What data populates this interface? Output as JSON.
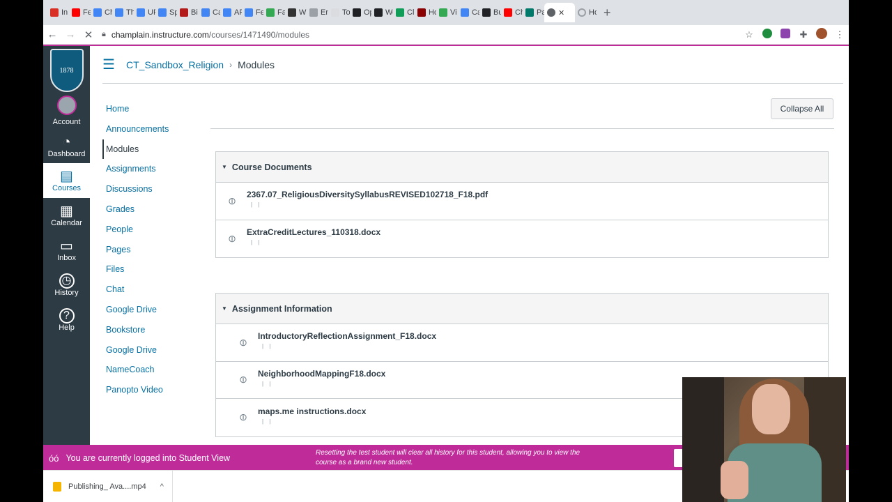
{
  "browser": {
    "tabs": [
      {
        "label": "In",
        "color": "#d93025"
      },
      {
        "label": "Fe",
        "color": "#ff0000"
      },
      {
        "label": "Ch",
        "color": "#4285f4"
      },
      {
        "label": "Th",
        "color": "#4285f4"
      },
      {
        "label": "UF",
        "color": "#4285f4"
      },
      {
        "label": "Sp",
        "color": "#4285f4"
      },
      {
        "label": "Bi",
        "color": "#b31b1b"
      },
      {
        "label": "Ca",
        "color": "#4285f4"
      },
      {
        "label": "AF",
        "color": "#4285f4"
      },
      {
        "label": "Fe",
        "color": "#4285f4"
      },
      {
        "label": "Fa",
        "color": "#34a853"
      },
      {
        "label": "W",
        "color": "#333333"
      },
      {
        "label": "En",
        "color": "#9aa0a6"
      },
      {
        "label": "To",
        "color": "#dadce0"
      },
      {
        "label": "Op",
        "color": "#202124"
      },
      {
        "label": "We",
        "color": "#202124"
      },
      {
        "label": "Cl",
        "color": "#0f9d58"
      },
      {
        "label": "Ho",
        "color": "#8b0000"
      },
      {
        "label": "Vi",
        "color": "#34a853"
      },
      {
        "label": "Ca",
        "color": "#4285f4"
      },
      {
        "label": "Bu",
        "color": "#202124"
      },
      {
        "label": "Ch",
        "color": "#ff0000"
      },
      {
        "label": "Pa",
        "color": "#00796b"
      }
    ],
    "active_tab_close": "✕",
    "last_tab": {
      "label": "Ho",
      "color": "#9aa0a6"
    },
    "new_tab": "+",
    "url_host": "champlain.instructure.com",
    "url_path": "/courses/1471490/modules"
  },
  "global_nav": {
    "logo_text": "1878",
    "items": [
      {
        "label": "Account",
        "icon": "avatar"
      },
      {
        "label": "Dashboard",
        "icon": "dashboard-icon"
      },
      {
        "label": "Courses",
        "icon": "courses-icon"
      },
      {
        "label": "Calendar",
        "icon": "calendar-icon"
      },
      {
        "label": "Inbox",
        "icon": "inbox-icon"
      },
      {
        "label": "History",
        "icon": "history-icon"
      },
      {
        "label": "Help",
        "icon": "help-icon"
      }
    ]
  },
  "header": {
    "course": "CT_Sandbox_Religion",
    "separator": "›",
    "page": "Modules"
  },
  "course_nav": {
    "items": [
      "Home",
      "Announcements",
      "Modules",
      "Assignments",
      "Discussions",
      "Grades",
      "People",
      "Pages",
      "Files",
      "Chat",
      "Google Drive",
      "Bookstore",
      "Google Drive",
      "NameCoach",
      "Panopto Video"
    ],
    "active": "Modules"
  },
  "collapse_all_label": "Collapse All",
  "modules": [
    {
      "title": "Course Documents",
      "items": [
        {
          "title": "2367.07_ReligiousDiversitySyllabusREVISED102718_F18.pdf",
          "meta": "| |"
        },
        {
          "title": "ExtraCreditLectures_110318.docx",
          "meta": "| |"
        }
      ]
    },
    {
      "title": "Assignment Information",
      "items": [
        {
          "title": "IntroductoryReflectionAssignment_F18.docx",
          "meta": "| |"
        },
        {
          "title": "NeighborhoodMappingF18.docx",
          "meta": "| |"
        },
        {
          "title": "maps.me instructions.docx",
          "meta": "| |"
        }
      ]
    }
  ],
  "student_view": {
    "message": "You are currently logged into Student View",
    "reset_note": "Resetting the test student will clear all history for this student, allowing you to view the course as a brand new student."
  },
  "downloads": {
    "file": "Publishing_ Ava....mp4"
  },
  "colors": {
    "canvas_nav": "#2d3b45",
    "link": "#0770a3",
    "student_view": "#c02b9a"
  }
}
